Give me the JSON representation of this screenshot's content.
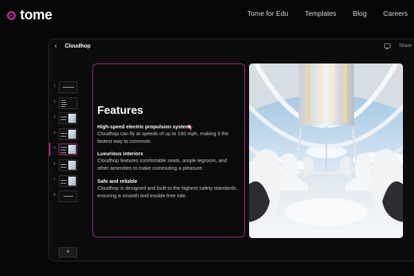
{
  "brand": {
    "name": "tome",
    "accent_color": "#b0278f"
  },
  "nav": {
    "links": [
      "Tome for Edu",
      "Templates",
      "Blog",
      "Careers"
    ]
  },
  "editor": {
    "back_icon": "chevron-left-icon",
    "doc_title": "Cloudhop",
    "comment_icon": "comment-icon",
    "share_label": "Share"
  },
  "thumbnails": {
    "numbers": [
      "1",
      "2",
      "3",
      "4",
      "5",
      "6",
      "7",
      "8"
    ],
    "active_index": 5,
    "add_label": "+"
  },
  "slide": {
    "heading": "Features",
    "features": [
      {
        "title": "High-speed electric propulsion system",
        "desc": "Cloudhop can fly at speeds of up to 150 mph, making it the fastest way to commute."
      },
      {
        "title": "Luxurious interiors",
        "desc": "Cloudhop features comfortable seats, ample legroom, and other amenities to make commuting a pleasure."
      },
      {
        "title": "Safe and reliable",
        "desc": "Cloudhop is designed and built to the highest safety standards, ensuring a smooth and trouble-free ride."
      }
    ]
  }
}
